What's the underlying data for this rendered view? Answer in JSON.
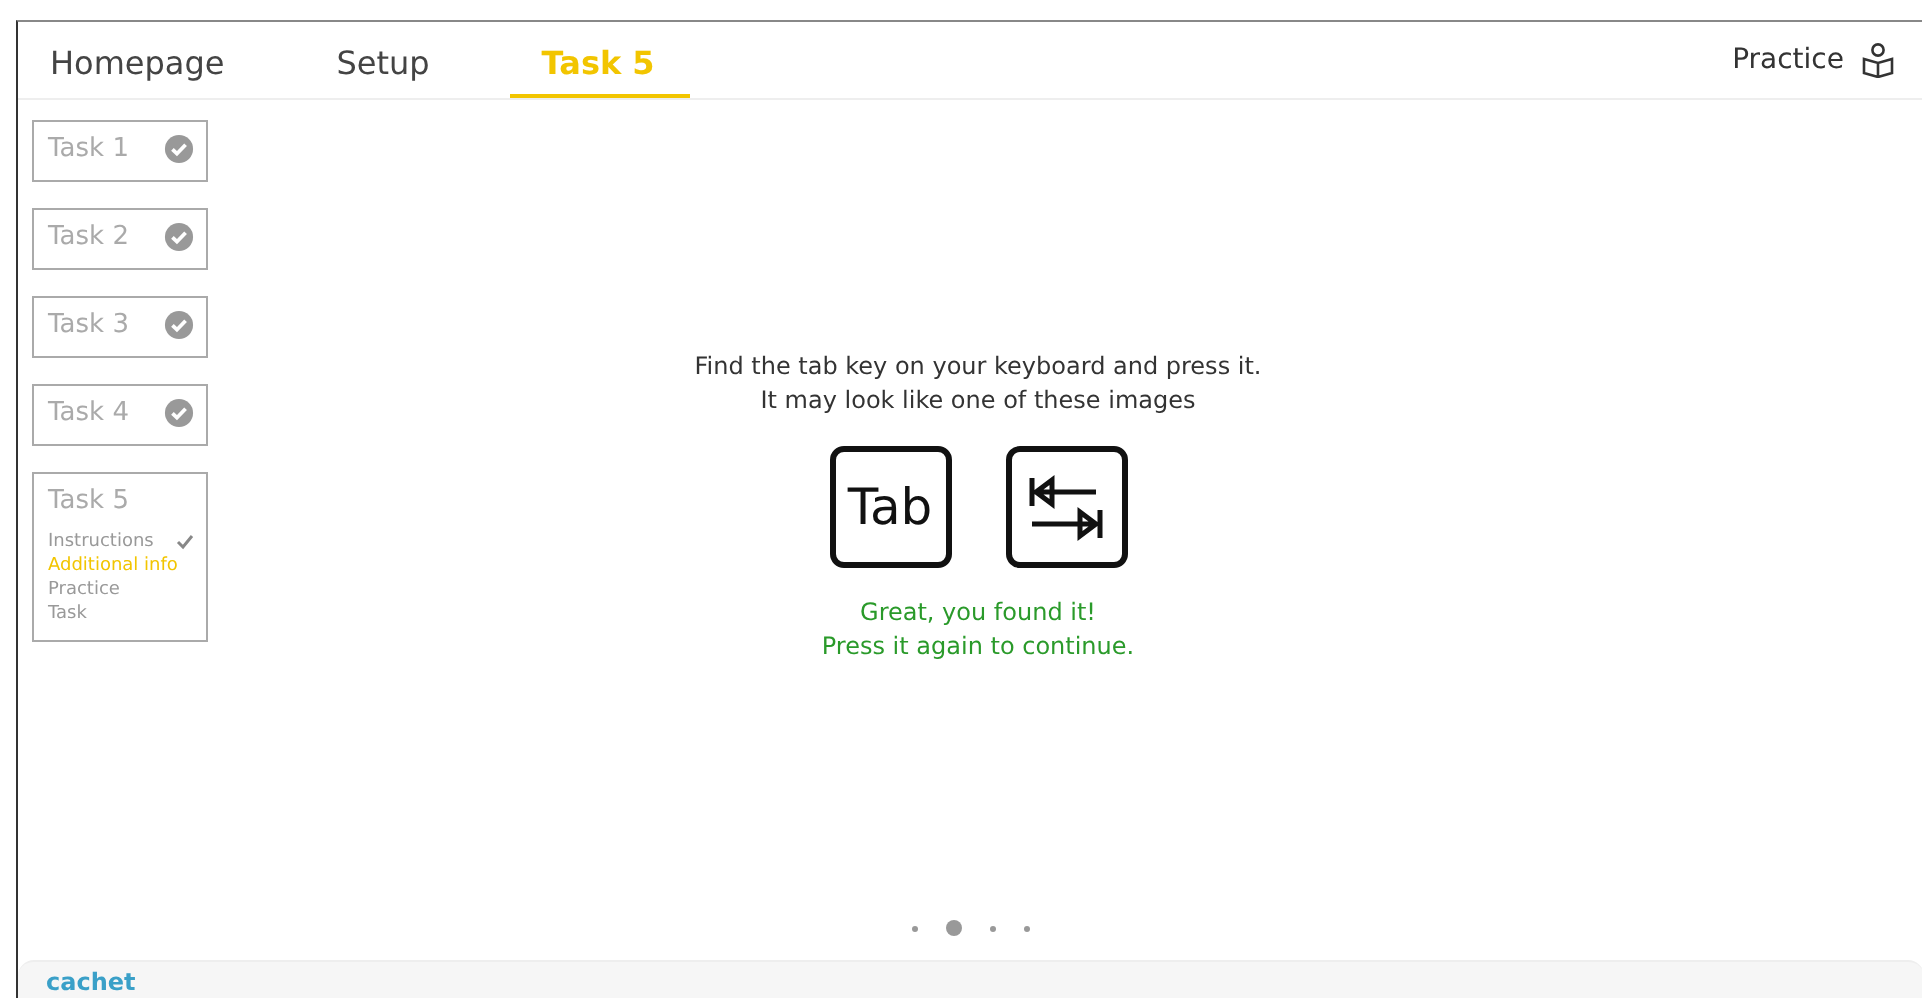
{
  "tabs": [
    {
      "label": "Homepage",
      "selected": false
    },
    {
      "label": "Setup",
      "selected": false
    },
    {
      "label": "Task 5",
      "selected": true
    }
  ],
  "mode": {
    "label": "Practice"
  },
  "tasks": [
    {
      "label": "Task 1",
      "done": true,
      "expanded": false
    },
    {
      "label": "Task 2",
      "done": true,
      "expanded": false
    },
    {
      "label": "Task 3",
      "done": true,
      "expanded": false
    },
    {
      "label": "Task 4",
      "done": true,
      "expanded": false
    },
    {
      "label": "Task 5",
      "done": false,
      "expanded": true,
      "steps": [
        {
          "label": "Instructions",
          "done": true,
          "selected": false
        },
        {
          "label": "Additional info",
          "done": false,
          "selected": true
        },
        {
          "label": "Practice",
          "done": false,
          "selected": false
        },
        {
          "label": "Task",
          "done": false,
          "selected": false
        }
      ]
    }
  ],
  "instructions": [
    "Find the tab key on your keyboard and press it.",
    "It may look like one of these images"
  ],
  "keys": [
    {
      "kind": "text",
      "label": "Tab"
    },
    {
      "kind": "arrows"
    }
  ],
  "feedback": [
    "Great, you found it!",
    "Press it again to continue."
  ],
  "pager": [
    {
      "selected": false
    },
    {
      "selected": true
    },
    {
      "selected": false
    },
    {
      "selected": false
    }
  ],
  "footer": {
    "logo": "cachet"
  }
}
